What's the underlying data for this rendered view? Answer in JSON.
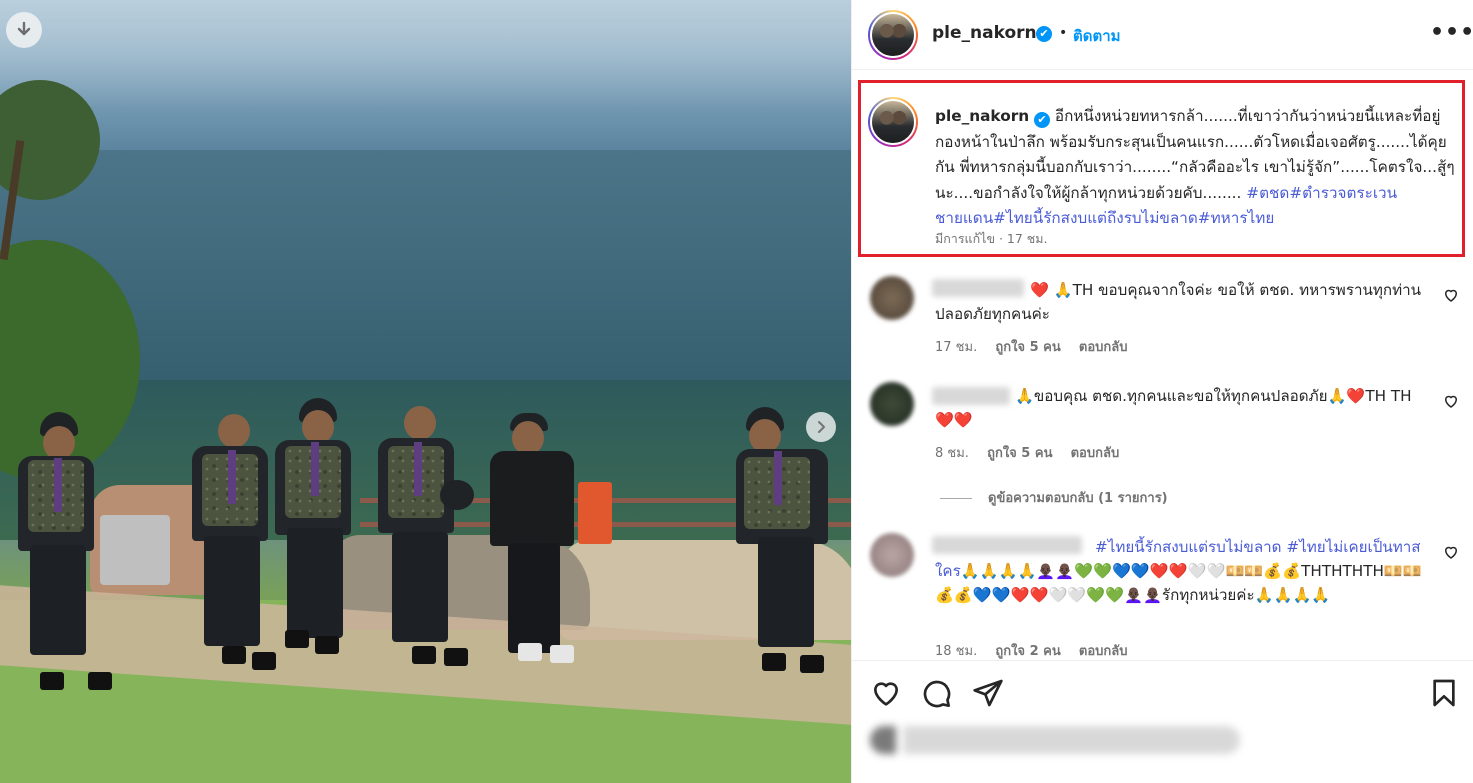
{
  "post": {
    "username": "ple_nakorn",
    "verified_mark": "✔",
    "separator": "•",
    "follow_label": "ติดตาม",
    "more_label": "•••"
  },
  "caption": {
    "username": "ple_nakorn",
    "text": "อีกหนึ่งหน่วยทหารกล้า.......ที่เขาว่ากันว่าหน่วยนี้แหละที่อยู่กองหน้าในป่าลึก พร้อมรับกระสุนเป็นคนแรก......ตัวโหดเมื่อเจอศัตรู.......ได้คุยกัน พี่ทหารกลุ่มนี้บอกกับเราว่า........“กลัวคืออะไร เขาไม่รู้จัก”......โคตรใจ...สู้ๆนะ....ขอกำลังใจให้ผู้กล้าทุกหน่วยด้วยคับ........",
    "hashtags": "#ตชด#ตำรวจตระเวนชายแดน#ไทยนี้รักสงบแต่ถึงรบไม่ขลาด#ทหารไทย",
    "edited": "มีการแก้ไข",
    "time": "17 ชม."
  },
  "comments": [
    {
      "text": "❤️ 🙏TH ขอบคุณจากใจค่ะ ขอให้ ตชด. ทหารพรานทุกท่านปลอดภัยทุกคนค่ะ",
      "time": "17 ชม.",
      "likes": "ถูกใจ 5 คน",
      "reply": "ตอบกลับ"
    },
    {
      "text": "🙏ขอบคุณ ตชด.ทุกคนและขอให้ทุกคนปลอดภัย🙏❤️TH TH❤️❤️",
      "time": "8 ชม.",
      "likes": "ถูกใจ 5 คน",
      "reply": "ตอบกลับ"
    },
    {
      "hashtags": "#ไทยนี้รักสงบแต่รบไม่ขลาด #ไทยไม่เคยเป็นทาสใคร",
      "text": "🙏🙏🙏🙏👩🏿‍🦲👩🏿‍🦲💚💚💙💙❤️❤️🤍🤍💴💴💰💰THTHTHTH💴💴💰💰💙💙❤️❤️🤍🤍💚💚👩🏿‍🦲👩🏿‍🦲รักทุกหน่วยค่ะ🙏🙏🙏🙏",
      "time": "18 ชม.",
      "likes": "ถูกใจ 2 คน",
      "reply": "ตอบกลับ"
    }
  ],
  "view_replies": "ดูข้อความตอบกลับ (1 รายการ)",
  "icons": {
    "download": "download-icon",
    "next": "chevron-right-icon",
    "like": "heart-icon",
    "comment": "comment-icon",
    "share": "share-icon",
    "save": "bookmark-icon"
  },
  "colors": {
    "accent": "#0095f6",
    "hashtag": "#4a5bd6",
    "highlight_border": "#e0212b",
    "muted": "#737373"
  }
}
